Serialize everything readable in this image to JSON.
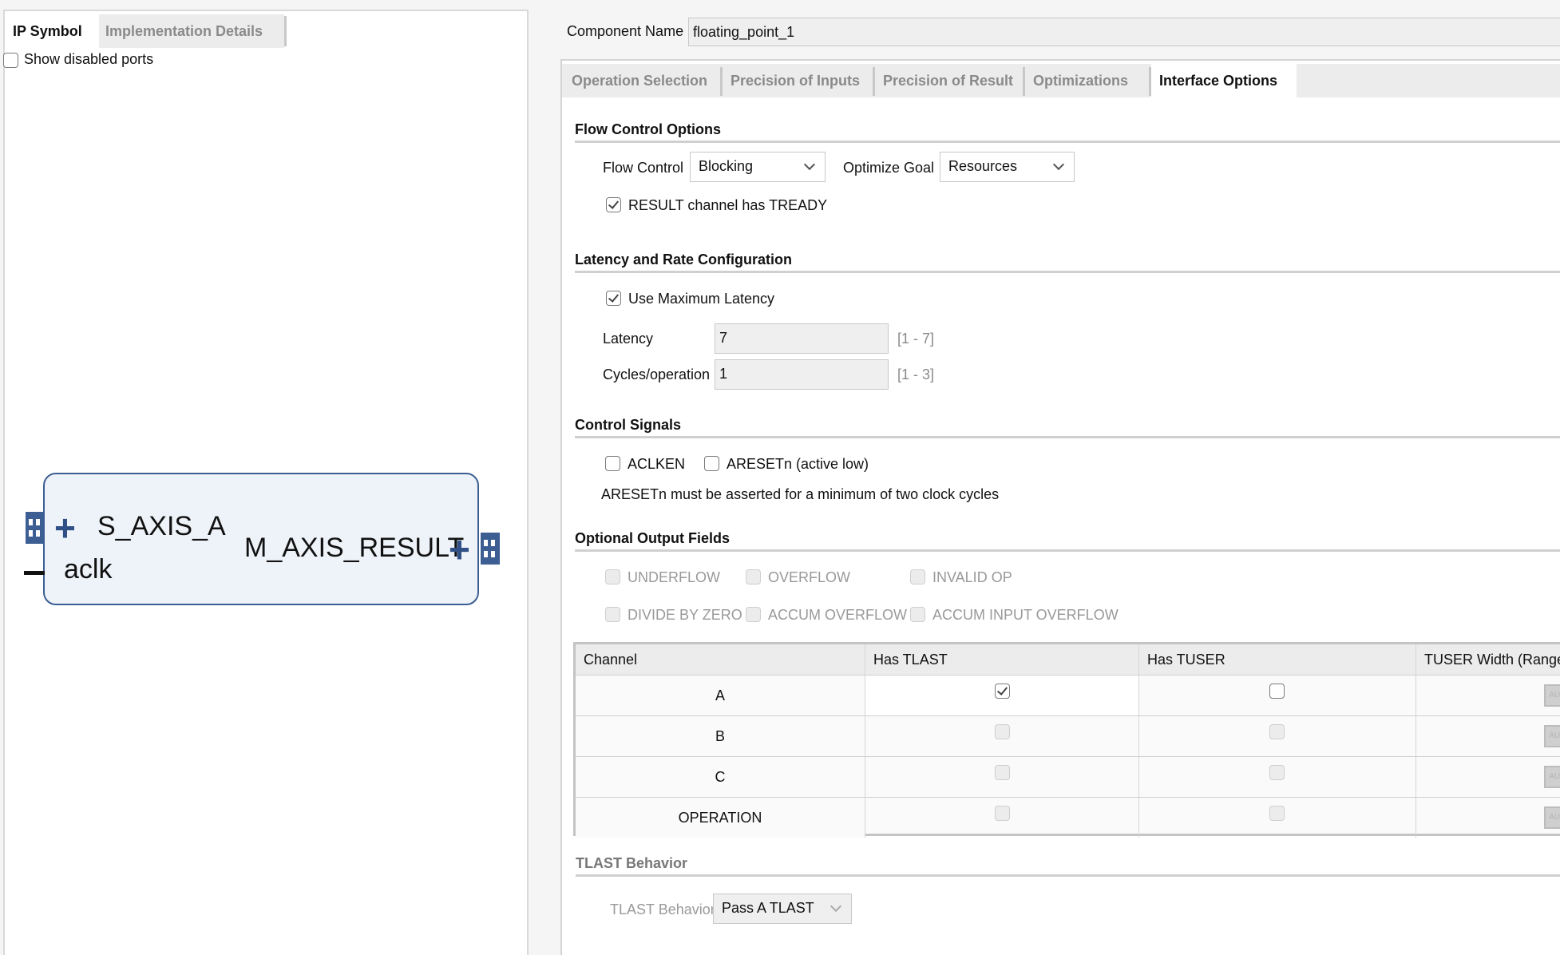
{
  "left_panel": {
    "tabs": [
      {
        "label": "IP Symbol",
        "active": true
      },
      {
        "label": "Implementation Details",
        "active": false
      }
    ],
    "show_disabled_ports": {
      "label": "Show disabled ports",
      "checked": false
    },
    "ip_symbol": {
      "left_ports": [
        {
          "name": "S_AXIS_A",
          "type": "bus",
          "expand_icon": "plus-icon"
        },
        {
          "name": "aclk",
          "type": "wire"
        }
      ],
      "right_ports": [
        {
          "name": "M_AXIS_RESULT",
          "type": "bus",
          "expand_icon": "plus-icon"
        }
      ]
    }
  },
  "component": {
    "label": "Component Name",
    "value": "floating_point_1"
  },
  "tabs": [
    {
      "label": "Operation Selection",
      "active": false
    },
    {
      "label": "Precision of Inputs",
      "active": false
    },
    {
      "label": "Precision of Result",
      "active": false
    },
    {
      "label": "Optimizations",
      "active": false
    },
    {
      "label": "Interface Options",
      "active": true
    }
  ],
  "flow_control": {
    "title": "Flow Control Options",
    "flow_control_label": "Flow Control",
    "flow_control_value": "Blocking",
    "optimize_goal_label": "Optimize Goal",
    "optimize_goal_value": "Resources",
    "tready": {
      "label": "RESULT channel has TREADY",
      "checked": true
    }
  },
  "latency": {
    "title": "Latency and Rate Configuration",
    "use_max": {
      "label": "Use Maximum Latency",
      "checked": true
    },
    "latency_label": "Latency",
    "latency_value": "7",
    "latency_range": "[1 - 7]",
    "cycles_label": "Cycles/operation",
    "cycles_value": "1",
    "cycles_range": "[1 - 3]"
  },
  "control_signals": {
    "title": "Control Signals",
    "aclken": {
      "label": "ACLKEN",
      "checked": false
    },
    "aresetn": {
      "label": "ARESETn (active low)",
      "checked": false
    },
    "note": "ARESETn must be asserted for a minimum of two clock cycles"
  },
  "optional_outputs": {
    "title": "Optional Output Fields",
    "fields": [
      {
        "label": "UNDERFLOW",
        "checked": false,
        "enabled": false
      },
      {
        "label": "OVERFLOW",
        "checked": false,
        "enabled": false
      },
      {
        "label": "INVALID OP",
        "checked": false,
        "enabled": false
      },
      {
        "label": "DIVIDE BY ZERO",
        "checked": false,
        "enabled": false
      },
      {
        "label": "ACCUM OVERFLOW",
        "checked": false,
        "enabled": false
      },
      {
        "label": "ACCUM INPUT OVERFLOW",
        "checked": false,
        "enabled": false
      }
    ]
  },
  "channel_table": {
    "headers": [
      "Channel",
      "Has TLAST",
      "Has TUSER",
      "TUSER Width (Range:"
    ],
    "rows": [
      {
        "channel": "A",
        "has_tlast": true,
        "tlast_enabled": true,
        "has_tuser": false,
        "tuser_enabled": true,
        "tuser_width": "AUTO"
      },
      {
        "channel": "B",
        "has_tlast": false,
        "tlast_enabled": false,
        "has_tuser": false,
        "tuser_enabled": false,
        "tuser_width": "AUTO"
      },
      {
        "channel": "C",
        "has_tlast": false,
        "tlast_enabled": false,
        "has_tuser": false,
        "tuser_enabled": false,
        "tuser_width": "AUTO"
      },
      {
        "channel": "OPERATION",
        "has_tlast": false,
        "tlast_enabled": false,
        "has_tuser": false,
        "tuser_enabled": false,
        "tuser_width": "AUTO"
      }
    ]
  },
  "tlast_behavior": {
    "title": "TLAST Behavior",
    "label": "TLAST Behavior",
    "value": "Pass A TLAST",
    "enabled": false
  }
}
